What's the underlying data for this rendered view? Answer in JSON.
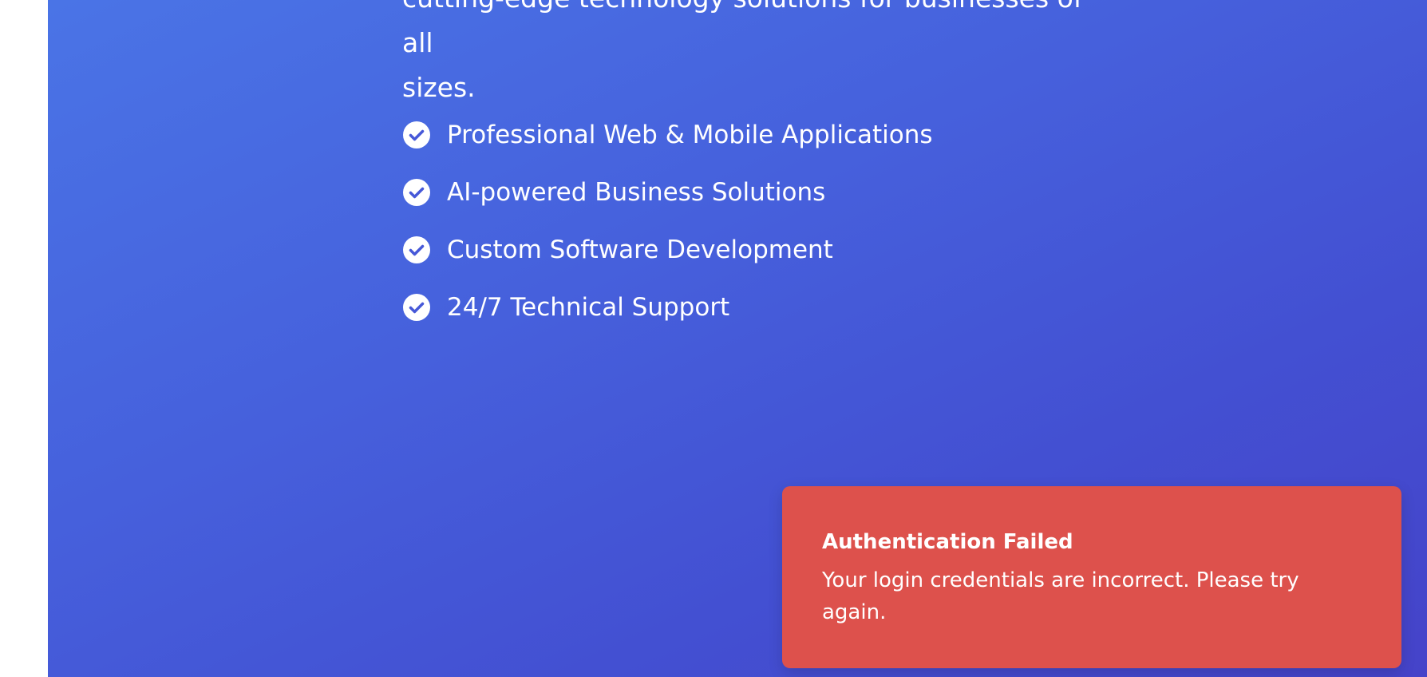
{
  "hero": {
    "intro_line1": "cutting-edge technology solutions for businesses of all",
    "intro_line2": "sizes.",
    "features": [
      {
        "label": "Professional Web & Mobile Applications",
        "icon": "check-circle-icon"
      },
      {
        "label": "AI-powered Business Solutions",
        "icon": "check-circle-icon"
      },
      {
        "label": "Custom Software Development",
        "icon": "check-circle-icon"
      },
      {
        "label": "24/7 Technical Support",
        "icon": "check-circle-icon"
      }
    ]
  },
  "toast": {
    "title": "Authentication Failed",
    "message": "Your login credentials are incorrect. Please try again.",
    "color": "#dd514c"
  },
  "colors": {
    "hero_gradient_start": "#4a74e6",
    "hero_gradient_end": "#4543c9"
  }
}
